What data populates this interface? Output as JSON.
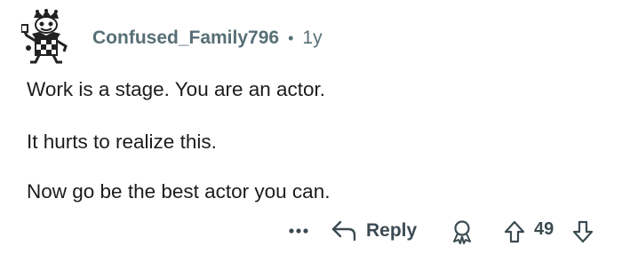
{
  "comment": {
    "username": "Confused_Family796",
    "separator": "•",
    "time": "1y",
    "lines": [
      "Work is a stage. You are an actor.",
      "It hurts to realize this.",
      "Now go be the best actor you can."
    ]
  },
  "actions": {
    "more_label": "•••",
    "reply_label": "Reply",
    "vote_count": "49"
  },
  "icons": {
    "avatar": "avatar-illustration",
    "more": "ellipsis-icon",
    "reply": "reply-arrow-icon",
    "award": "award-icon",
    "upvote": "upvote-arrow-icon",
    "downvote": "downvote-arrow-icon"
  },
  "colors": {
    "meta": "#576f76",
    "text": "#1c1c1c",
    "action": "#3c4b52"
  }
}
